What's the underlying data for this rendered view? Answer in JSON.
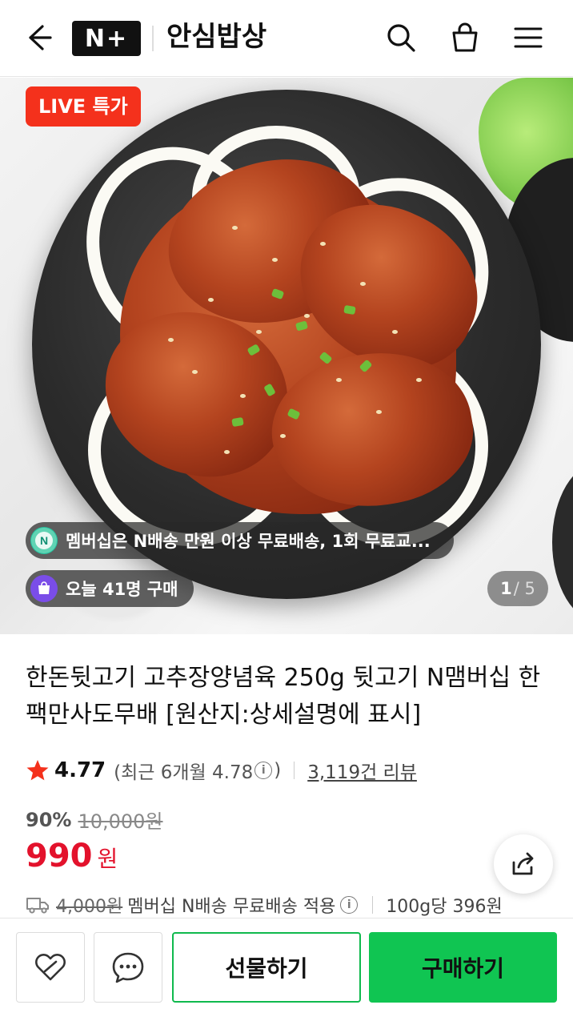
{
  "header": {
    "logo_text": "N+",
    "store_name": "안심밥상"
  },
  "hero": {
    "live_badge": "LIVE 특가",
    "membership_notice": "멤버십은 N배송 만원 이상 무료배송, 1회 무료교...",
    "purchase_count": "오늘 41명 구매",
    "image_index": "1",
    "image_total": "/ 5"
  },
  "product": {
    "title": "한돈뒷고기 고추장양념육 250g 뒷고기 N맴버십 한팩만사도무배 [원산지:상세설명에 표시]",
    "rating": "4.77",
    "recent_rating": "(최근 6개월 4.78",
    "recent_rating_close": ")",
    "review_count": "3,119건 리뷰",
    "discount": "90%",
    "original_price": "10,000원",
    "price": "990",
    "currency": "원",
    "shipping_original": "4,000원",
    "shipping_text": "멤버십 N배송 무료배송 적용",
    "unit_price": "100g당 396원"
  },
  "actions": {
    "gift_label": "선물하기",
    "buy_label": "구매하기"
  },
  "colors": {
    "accent_green": "#10c552",
    "price_red": "#e3122c",
    "live_red": "#f4311c"
  }
}
